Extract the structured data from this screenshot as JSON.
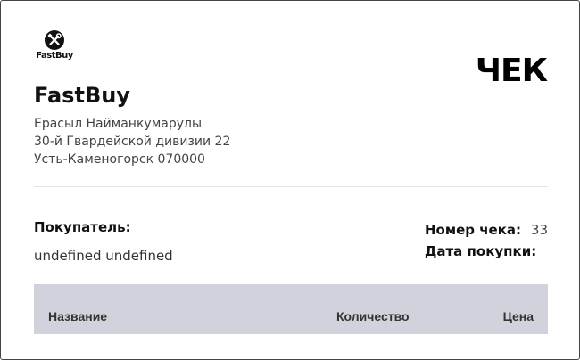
{
  "logo": {
    "icon": "tools-icon",
    "text": "FastBuy"
  },
  "document": {
    "title": "ЧЕК"
  },
  "seller": {
    "company": "FastBuy",
    "owner": "Ерасыл Найманкумарулы",
    "street": "30-й Гвардейской дивизии 22",
    "city": "Усть-Каменогорск 070000"
  },
  "buyer": {
    "label": "Покупатель:",
    "value": "undefined undefined"
  },
  "receipt": {
    "number_label": "Номер чека:",
    "number_value": "33",
    "date_label": "Дата покупки:",
    "date_value": ""
  },
  "table": {
    "columns": [
      "Название",
      "Количество",
      "Цена"
    ],
    "header_color": "#d0d3db"
  }
}
